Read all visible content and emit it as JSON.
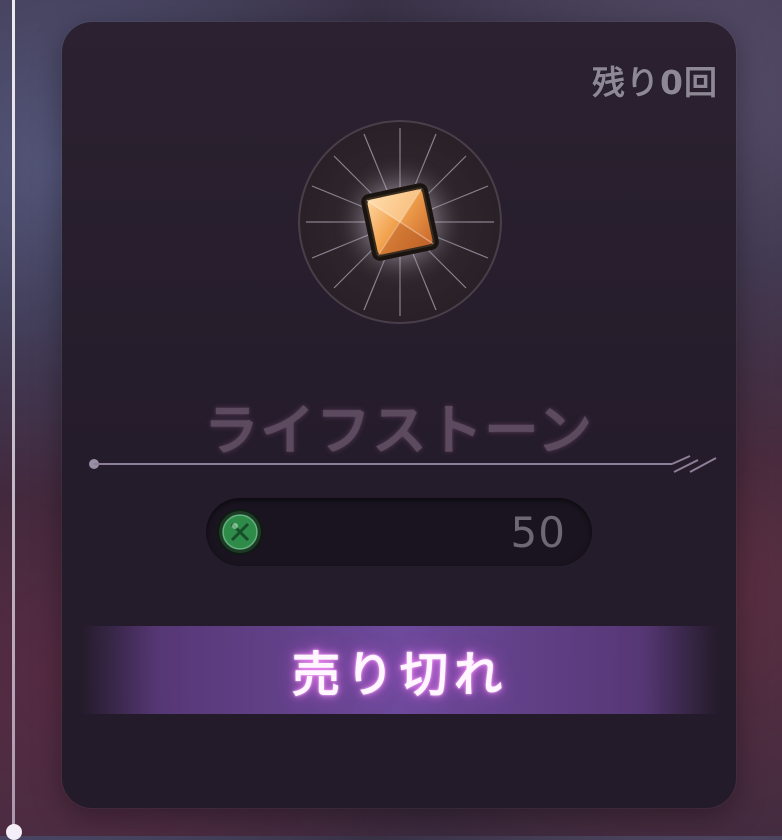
{
  "card": {
    "remaining": "残り0回",
    "item": {
      "name": "ライフストーン",
      "icon": "life-stone-icon"
    },
    "price": {
      "currency_icon": "green-coin-icon",
      "value": "50"
    },
    "action": {
      "label": "売り切れ"
    }
  },
  "colors": {
    "card_bg": "#251c2b",
    "accent_purple": "#6e4a9c",
    "glow_pink": "#ff8cff",
    "gem_orange": "#f0a050",
    "coin_green": "#2e8b4a"
  }
}
